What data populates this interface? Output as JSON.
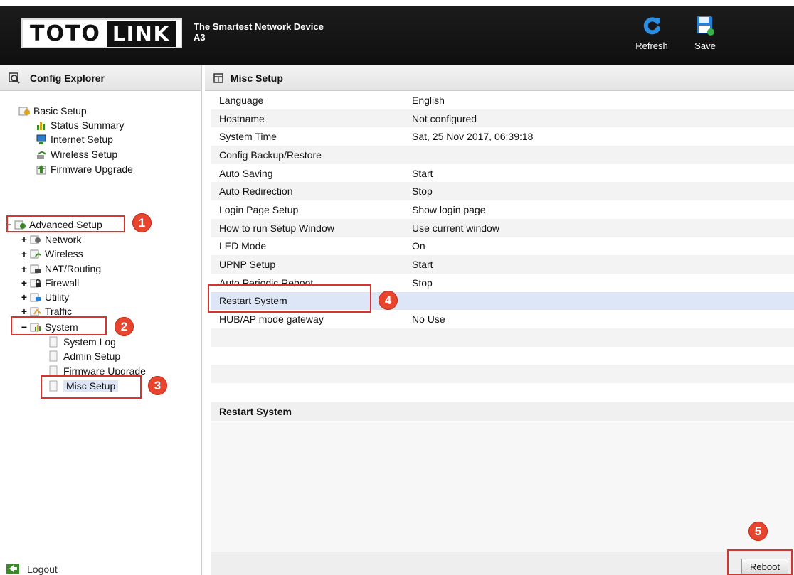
{
  "header": {
    "logo_part1": "TOTO",
    "logo_part2": "LINK",
    "tagline": "The Smartest Network Device",
    "model": "A3",
    "refresh_label": "Refresh",
    "save_label": "Save"
  },
  "left": {
    "title": "Config Explorer",
    "basic": {
      "label": "Basic Setup",
      "items": [
        "Status Summary",
        "Internet Setup",
        "Wireless Setup",
        "Firmware Upgrade"
      ]
    },
    "advanced": {
      "toggle": "−",
      "label": "Advanced Setup",
      "items": [
        {
          "toggle": "+",
          "label": "Network"
        },
        {
          "toggle": "+",
          "label": "Wireless"
        },
        {
          "toggle": "+",
          "label": "NAT/Routing"
        },
        {
          "toggle": "+",
          "label": "Firewall"
        },
        {
          "toggle": "+",
          "label": "Utility"
        },
        {
          "toggle": "+",
          "label": "Traffic"
        }
      ],
      "system": {
        "toggle": "−",
        "label": "System",
        "items": [
          "System Log",
          "Admin Setup",
          "Firmware Upgrade",
          "Misc Setup"
        ]
      }
    },
    "logout_label": "Logout"
  },
  "main": {
    "title": "Misc Setup",
    "rows": [
      {
        "key": "Language",
        "value": "English"
      },
      {
        "key": "Hostname",
        "value": "Not configured"
      },
      {
        "key": "System Time",
        "value": "Sat, 25 Nov 2017, 06:39:18"
      },
      {
        "key": "Config Backup/Restore",
        "value": ""
      },
      {
        "key": "Auto Saving",
        "value": "Start"
      },
      {
        "key": "Auto Redirection",
        "value": "Stop"
      },
      {
        "key": "Login Page Setup",
        "value": "Show login page"
      },
      {
        "key": "How to run Setup Window",
        "value": "Use current window"
      },
      {
        "key": "LED Mode",
        "value": "On"
      },
      {
        "key": "UPNP Setup",
        "value": "Start"
      },
      {
        "key": "Auto Periodic Reboot",
        "value": "Stop"
      },
      {
        "key": "Restart System",
        "value": ""
      },
      {
        "key": "HUB/AP mode gateway",
        "value": "No Use"
      },
      {
        "key": "",
        "value": ""
      },
      {
        "key": "",
        "value": ""
      },
      {
        "key": "",
        "value": ""
      },
      {
        "key": "",
        "value": ""
      }
    ],
    "sub_title": "Restart System",
    "reboot_label": "Reboot"
  },
  "annotations": [
    "1",
    "2",
    "3",
    "4",
    "5"
  ],
  "colors": {
    "highlight": "#dde6f6",
    "annotation": "#e8452f",
    "header_bg": "#111111"
  }
}
